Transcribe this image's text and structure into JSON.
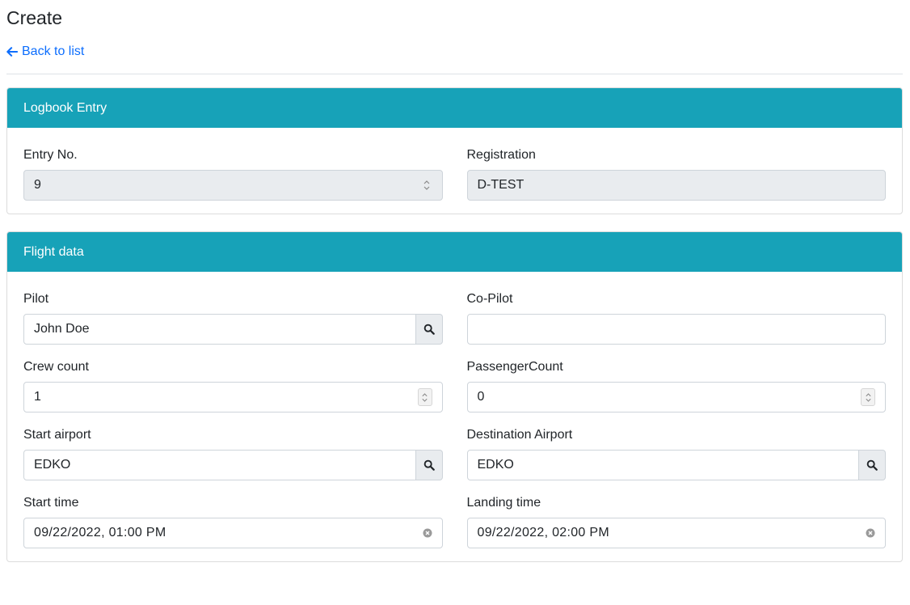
{
  "page": {
    "title": "Create",
    "back_label": "Back to list"
  },
  "logbook": {
    "header": "Logbook Entry",
    "entry_no": {
      "label": "Entry No.",
      "value": "9"
    },
    "registration": {
      "label": "Registration",
      "value": "D-TEST"
    }
  },
  "flight": {
    "header": "Flight data",
    "pilot": {
      "label": "Pilot",
      "value": "John Doe"
    },
    "copilot": {
      "label": "Co-Pilot",
      "value": ""
    },
    "crew_count": {
      "label": "Crew count",
      "value": "1"
    },
    "passenger_count": {
      "label": "PassengerCount",
      "value": "0"
    },
    "start_airport": {
      "label": "Start airport",
      "value": "EDKO"
    },
    "destination_airport": {
      "label": "Destination Airport",
      "value": "EDKO"
    },
    "start_time": {
      "label": "Start time",
      "value": "09/22/2022, 01:00  PM"
    },
    "landing_time": {
      "label": "Landing time",
      "value": "09/22/2022, 02:00  PM"
    }
  },
  "colors": {
    "header_bg": "#17a2b8",
    "link": "#0d6efd",
    "readonly_bg": "#e9ecef"
  }
}
